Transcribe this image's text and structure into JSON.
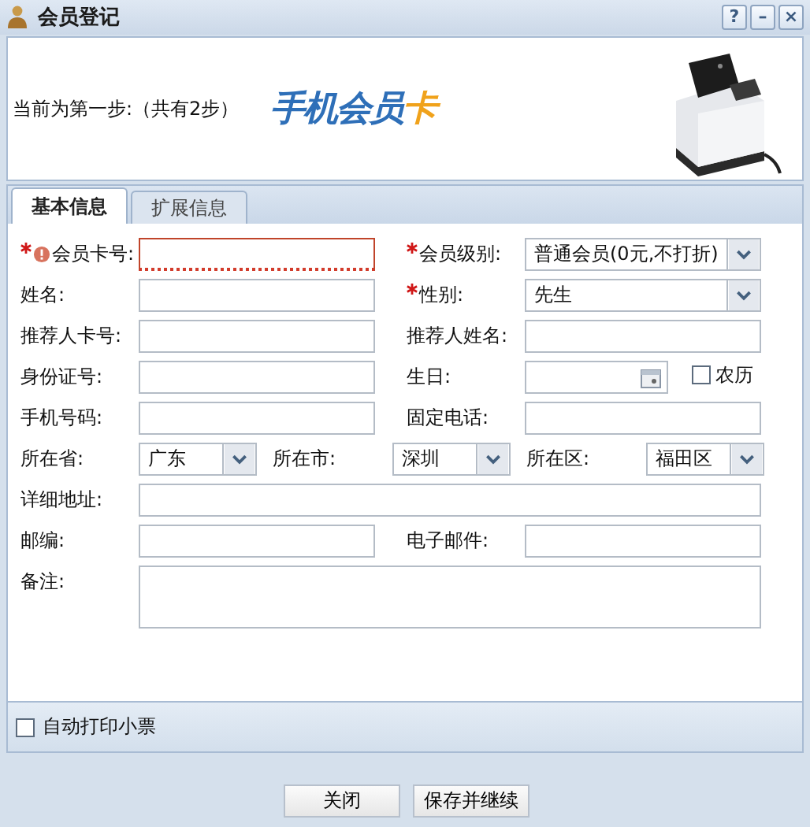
{
  "window": {
    "title": "会员登记",
    "controls": [
      "?",
      "–",
      "×"
    ]
  },
  "header": {
    "step": "当前为第一步:（共有2步）",
    "logo": {
      "text": "手机会员",
      "accent": "卡"
    }
  },
  "tabs": [
    {
      "label": "基本信息",
      "selected": true
    },
    {
      "label": "扩展信息",
      "selected": false
    }
  ],
  "rows": [
    [
      {
        "label": "会员卡号:",
        "required": true,
        "kind": "text",
        "error": true
      },
      {
        "label": "会员级别:",
        "required": true,
        "kind": "select",
        "value": "普通会员(0元,不打折)"
      }
    ],
    [
      {
        "label": "姓名:",
        "required": false,
        "kind": "text"
      },
      {
        "label": "性别:",
        "required": true,
        "kind": "select",
        "value": "先生"
      }
    ],
    [
      {
        "label": "推荐人卡号:",
        "required": false,
        "kind": "text"
      },
      {
        "label": "推荐人姓名:",
        "required": false,
        "kind": "text"
      }
    ],
    [
      {
        "label": "身份证号:",
        "required": false,
        "kind": "text"
      },
      {
        "label": "生日:",
        "required": false,
        "kind": "date",
        "option": {
          "label": "农历",
          "checked": false
        }
      }
    ],
    [
      {
        "label": "手机号码:",
        "required": false,
        "kind": "text"
      },
      {
        "label": "固定电话:",
        "required": false,
        "kind": "text"
      }
    ],
    [
      {
        "label": "所在省:",
        "required": false,
        "kind": "select",
        "value": "广东"
      },
      {
        "label": "所在市:",
        "required": false,
        "kind": "select",
        "value": "深圳"
      },
      {
        "label": "所在区:",
        "required": false,
        "kind": "select",
        "value": "福田区"
      }
    ],
    [
      {
        "label": "详细地址:",
        "required": false,
        "kind": "text"
      }
    ],
    [
      {
        "label": "邮编:",
        "required": false,
        "kind": "text"
      },
      {
        "label": "电子邮件:",
        "required": false,
        "kind": "text"
      }
    ],
    [
      {
        "label": "备注:",
        "required": false,
        "kind": "textarea"
      }
    ]
  ],
  "auto_print": {
    "label": "自动打印小票",
    "checked": false
  },
  "buttons": [
    "关闭",
    "保存并继续"
  ]
}
